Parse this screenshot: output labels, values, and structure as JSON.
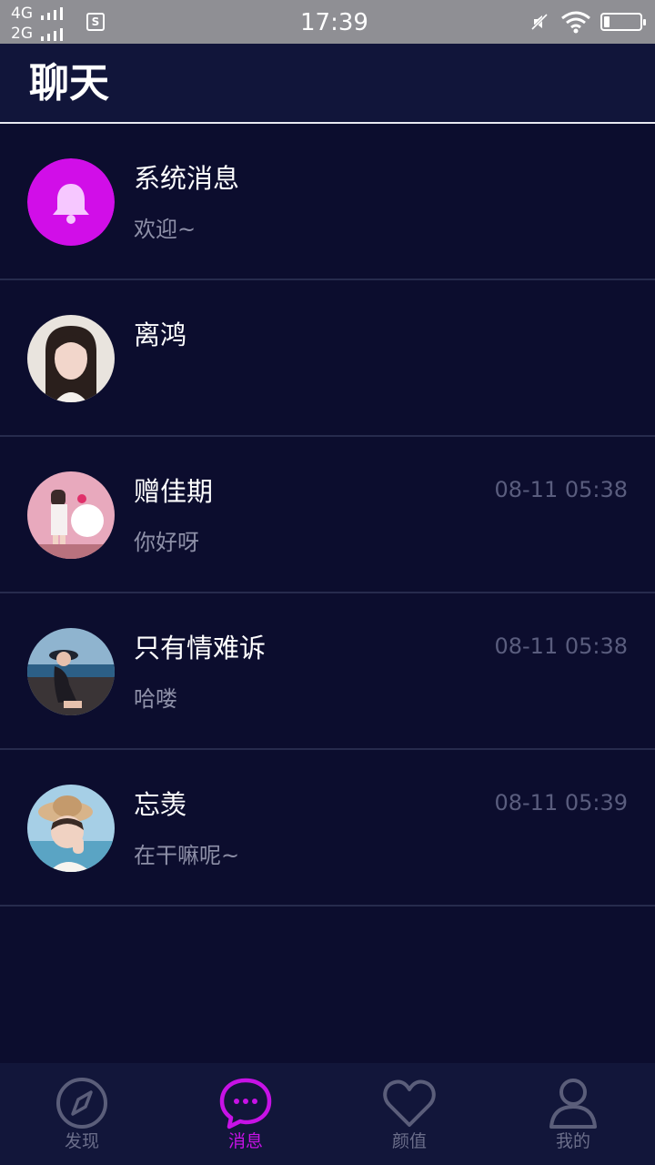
{
  "status_bar": {
    "network_top": "4G",
    "network_bottom": "2G",
    "sim_label": "S",
    "time": "17:39",
    "icons": [
      "signal-icon",
      "sim-icon",
      "mute-icon",
      "wifi-icon",
      "battery-icon"
    ]
  },
  "header": {
    "title": "聊天"
  },
  "chats": [
    {
      "name": "系统消息",
      "preview": "欢迎~",
      "time": "",
      "avatar": "bell-icon"
    },
    {
      "name": "离鸿",
      "preview": "",
      "time": "",
      "avatar": "user-photo"
    },
    {
      "name": "赠佳期",
      "preview": "你好呀",
      "time": "08-11 05:38",
      "avatar": "user-photo"
    },
    {
      "name": "只有情难诉",
      "preview": "哈喽",
      "time": "08-11 05:38",
      "avatar": "user-photo"
    },
    {
      "name": "忘羡",
      "preview": "在干嘛呢~",
      "time": "08-11 05:39",
      "avatar": "user-photo"
    }
  ],
  "nav": {
    "items": [
      {
        "label": "发现",
        "icon": "compass-icon",
        "active": false
      },
      {
        "label": "消息",
        "icon": "chat-bubble-icon",
        "active": true
      },
      {
        "label": "颜值",
        "icon": "heart-icon",
        "active": false
      },
      {
        "label": "我的",
        "icon": "person-icon",
        "active": false
      }
    ]
  },
  "colors": {
    "background": "#0c0d2e",
    "header": "#11153a",
    "accent": "#c712e6",
    "muted_text": "#8e90a8",
    "time_text": "#5a5d7e",
    "divider": "#272b4d",
    "status_bar": "#8f8f94"
  }
}
